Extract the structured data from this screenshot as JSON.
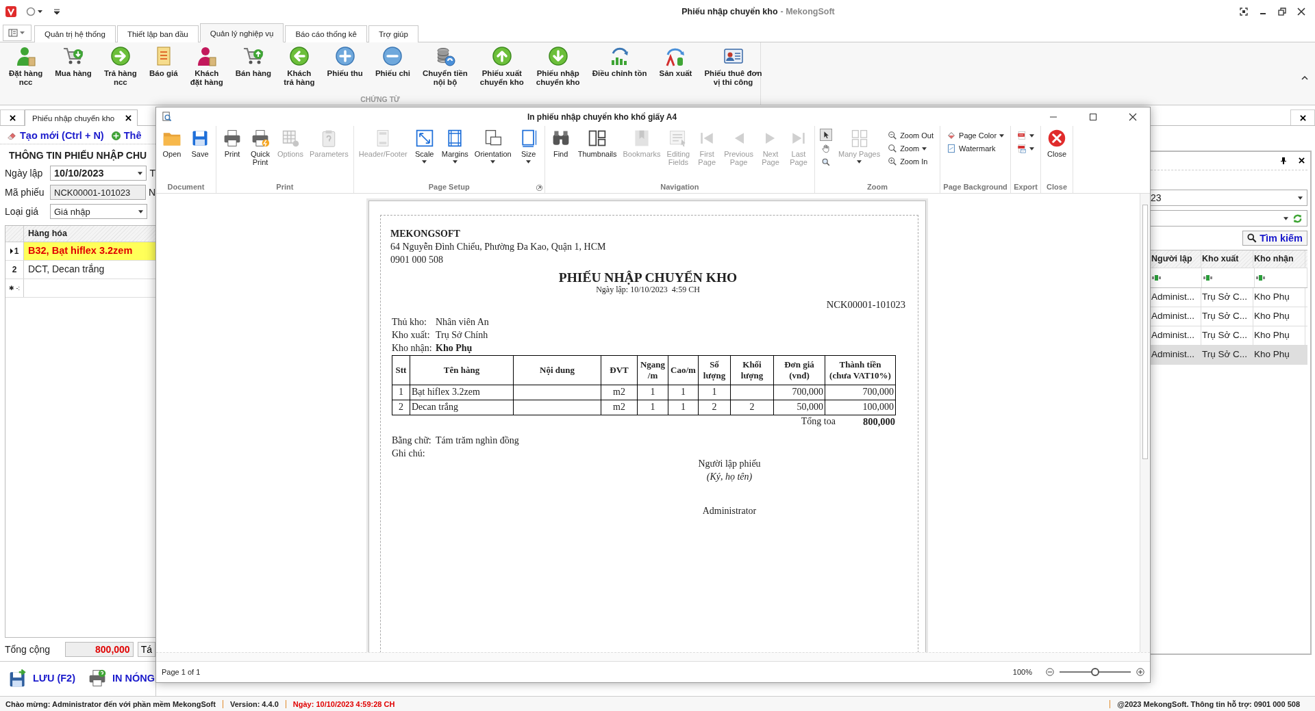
{
  "window": {
    "title": "Phiếu nhập chuyển kho",
    "app_name": "- MekongSoft"
  },
  "ribbon_tabs": [
    {
      "label": "Quản trị hệ thống",
      "selected": false
    },
    {
      "label": "Thiết lập ban đầu",
      "selected": false
    },
    {
      "label": "Quản lý nghiệp vụ",
      "selected": true
    },
    {
      "label": "Báo cáo thống kê",
      "selected": false
    },
    {
      "label": "Trợ giúp",
      "selected": false
    }
  ],
  "ribbon": {
    "group_label": "CHỨNG TỪ",
    "items": [
      {
        "label": "Đặt hàng\nncc",
        "kind": "person"
      },
      {
        "label": "Mua hàng",
        "kind": "cart-down"
      },
      {
        "label": "Trả hàng\nncc",
        "kind": "arrow-right"
      },
      {
        "label": "Báo giá",
        "kind": "doc"
      },
      {
        "label": "Khách\nđặt hàng",
        "kind": "person-pink"
      },
      {
        "label": "Bán hàng",
        "kind": "cart-up"
      },
      {
        "label": "Khách\ntrả hàng",
        "kind": "arrow-left"
      },
      {
        "label": "Phiếu thu",
        "kind": "plus"
      },
      {
        "label": "Phiếu chi",
        "kind": "minus"
      },
      {
        "label": "Chuyển tiền\nnội bộ",
        "kind": "coins"
      },
      {
        "label": "Phiếu xuất\nchuyển kho",
        "kind": "arrow-up"
      },
      {
        "label": "Phiếu nhập\nchuyển kho",
        "kind": "arrow-down"
      },
      {
        "label": "Điều chỉnh tồn",
        "kind": "chart"
      },
      {
        "label": "Sản xuất",
        "kind": "curve"
      },
      {
        "label": "Phiếu thuê đơn\nvị thi công",
        "kind": "card"
      }
    ]
  },
  "doc_tabs": [
    {
      "label": "Phiếu nhập chuyển kho",
      "selected": true
    }
  ],
  "left_panel": {
    "toolbar": [
      {
        "label": "Tạo mới (Ctrl + N)",
        "kind": "eraser"
      },
      {
        "label": "Thê",
        "kind": "add"
      }
    ],
    "section_title": "THÔNG TIN PHIẾU NHẬP CHU",
    "fields": [
      {
        "label": "Ngày lập",
        "value": "10/10/2023",
        "kind": "date",
        "side_label": "T"
      },
      {
        "label": "Mã phiếu",
        "value": "NCK00001-101023",
        "kind": "readonly",
        "side_label": "N"
      },
      {
        "label": "Loại giá",
        "value": "Giá nhập",
        "kind": "dropdown"
      }
    ],
    "grid": {
      "column": "Hàng hóa",
      "new_row_marker": "✱ -:",
      "rows": [
        {
          "row_header": "1",
          "text": "B32, Bạt hiflex 3.2zem",
          "selected": true
        },
        {
          "row_header": "2",
          "text": "DCT, Decan trắng",
          "selected": false
        }
      ]
    },
    "total": {
      "label": "Tổng cộng",
      "value": "800,000",
      "button": "Tá"
    },
    "actions": [
      {
        "label": "LƯU (F2)",
        "kind": "save"
      },
      {
        "label": "IN NÓNG",
        "kind": "print"
      }
    ]
  },
  "right_panel": {
    "combo_value": "23",
    "search_button": "Tìm kiếm",
    "grid": {
      "columns": [
        "Người lập",
        "Kho xuất",
        "Kho nhận"
      ],
      "rows": [
        {
          "cells": [
            "Administ...",
            "Trụ Sở C...",
            "Kho Phụ"
          ],
          "selected": false
        },
        {
          "cells": [
            "Administ...",
            "Trụ Sở C...",
            "Kho Phụ"
          ],
          "selected": false
        },
        {
          "cells": [
            "Administ...",
            "Trụ Sở C...",
            "Kho Phụ"
          ],
          "selected": false
        },
        {
          "cells": [
            "Administ...",
            "Trụ Sở C...",
            "Kho Phụ"
          ],
          "selected": true
        }
      ]
    }
  },
  "print_dialog": {
    "title": "In phiếu nhập chuyển kho khổ giấy A4",
    "toolbar": {
      "groups": [
        {
          "label": "Document",
          "launcher": false,
          "items": [
            {
              "label": "Open",
              "kind": "folder",
              "disabled": false,
              "dropdown": false
            },
            {
              "label": "Save",
              "kind": "disk",
              "disabled": false,
              "dropdown": false
            }
          ]
        },
        {
          "label": "Print",
          "launcher": false,
          "items": [
            {
              "label": "Print",
              "kind": "printer",
              "disabled": false,
              "dropdown": false
            },
            {
              "label": "Quick\nPrint",
              "kind": "quick-printer",
              "disabled": false,
              "dropdown": false
            },
            {
              "label": "Options",
              "kind": "options",
              "disabled": true,
              "dropdown": false
            },
            {
              "label": "Parameters",
              "kind": "clipboard",
              "disabled": true,
              "dropdown": false
            }
          ]
        },
        {
          "label": "Page Setup",
          "launcher": true,
          "items": [
            {
              "label": "Header/Footer",
              "kind": "header",
              "disabled": true,
              "dropdown": false
            },
            {
              "label": "Scale",
              "kind": "scale",
              "disabled": false,
              "dropdown": true
            },
            {
              "label": "Margins",
              "kind": "margins",
              "disabled": false,
              "dropdown": true
            },
            {
              "label": "Orientation",
              "kind": "orientation",
              "disabled": false,
              "dropdown": true
            },
            {
              "label": "Size",
              "kind": "size",
              "disabled": false,
              "dropdown": true
            }
          ]
        },
        {
          "label": "Navigation",
          "launcher": false,
          "items": [
            {
              "label": "Find",
              "kind": "binoculars",
              "disabled": false,
              "dropdown": false
            },
            {
              "label": "Thumbnails",
              "kind": "thumbnails",
              "disabled": false,
              "dropdown": false
            },
            {
              "label": "Bookmarks",
              "kind": "bookmark",
              "disabled": true,
              "dropdown": false
            },
            {
              "label": "Editing\nFields",
              "kind": "fields",
              "disabled": true,
              "dropdown": false
            },
            {
              "label": "First\nPage",
              "kind": "first",
              "disabled": true,
              "dropdown": false
            },
            {
              "label": "Previous\nPage",
              "kind": "prev",
              "disabled": true,
              "dropdown": false
            },
            {
              "label": "Next\nPage",
              "kind": "next",
              "disabled": true,
              "dropdown": false
            },
            {
              "label": "Last\nPage",
              "kind": "last",
              "disabled": true,
              "dropdown": false
            }
          ]
        },
        {
          "label": "Zoom",
          "launcher": false,
          "tools": [
            {
              "kind": "pointer",
              "selected": true
            },
            {
              "kind": "hand",
              "selected": false
            },
            {
              "kind": "magnifier",
              "selected": false
            }
          ],
          "items": [
            {
              "label": "Many Pages",
              "kind": "many-pages",
              "disabled": true,
              "dropdown": true
            }
          ],
          "small_items": [
            {
              "label": "Zoom Out",
              "kind": "zoom-out",
              "dropdown": false
            },
            {
              "label": "Zoom",
              "kind": "zoom",
              "dropdown": true
            },
            {
              "label": "Zoom In",
              "kind": "zoom-in",
              "dropdown": false
            }
          ]
        },
        {
          "label": "Page Background",
          "launcher": false,
          "small_items": [
            {
              "label": "Page Color",
              "kind": "page-color",
              "dropdown": true
            },
            {
              "label": "Watermark",
              "kind": "watermark",
              "dropdown": false
            }
          ]
        },
        {
          "label": "Export",
          "launcher": false,
          "small_items": [
            {
              "kind": "pdf",
              "dropdown": true
            },
            {
              "kind": "pdf-mail",
              "dropdown": true
            }
          ]
        },
        {
          "label": "Close",
          "launcher": false,
          "items": [
            {
              "label": "Close",
              "kind": "close",
              "disabled": false,
              "dropdown": false
            }
          ]
        }
      ]
    },
    "document": {
      "company": "MEKONGSOFT",
      "address": "64 Nguyễn Đình Chiểu, Phường Đa Kao, Quận 1, HCM",
      "phone": "0901 000 508",
      "title": "PHIẾU NHẬP CHUYỂN KHO",
      "date": "Ngày lập: 10/10/2023  4:59 CH",
      "number": "NCK00001-101023",
      "info": [
        {
          "label": "Thủ kho:",
          "value": "Nhân viên An"
        },
        {
          "label": "Kho xuất:",
          "value": "Trụ Sở Chính"
        },
        {
          "label": "Kho nhận:",
          "value": "**Kho Phụ**"
        }
      ],
      "table": {
        "columns": [
          "Stt",
          "Tên hàng",
          "Nội dung",
          "ĐVT",
          "Ngang\n/m",
          "Cao/m",
          "Số\nlượng",
          "Khối\nlượng",
          "Đơn giá\n(vnđ)",
          "Thành tiền\n(chưa VAT10%)"
        ],
        "rows": [
          [
            "1",
            "Bạt hiflex 3.2zem",
            null,
            "m2",
            "1",
            "1",
            "1",
            null,
            "700,000",
            "700,000"
          ],
          [
            "2",
            "Decan trắng",
            null,
            "m2",
            "1",
            "1",
            "2",
            "2",
            "50,000",
            "100,000"
          ]
        ]
      },
      "total": {
        "label": "Tổng toa",
        "value": "800,000"
      },
      "amount_in_words": {
        "label": "Bằng chữ:",
        "value": "Tám trăm nghìn đồng"
      },
      "note_label": "Ghi chú:",
      "signature": {
        "title": "Người lập phiếu",
        "hint": "(Ký, họ tên)",
        "name": "Administrator"
      }
    },
    "status": {
      "page": "Page 1 of 1",
      "zoom": "100%",
      "zoom_slider": {
        "level": 0.5
      }
    }
  },
  "status_bar": {
    "items": [
      {
        "text": "Chào mừng: Administrator đến với phần mềm MekongSoft",
        "kind": "info"
      },
      {
        "text": "Version: 4.4.0",
        "kind": "info"
      },
      {
        "text": "Ngày: 10/10/2023 4:59:28 CH",
        "kind": "alert"
      }
    ],
    "right": "@2023 MekongSoft. Thông tin hỗ trợ: 0901 000 508"
  }
}
